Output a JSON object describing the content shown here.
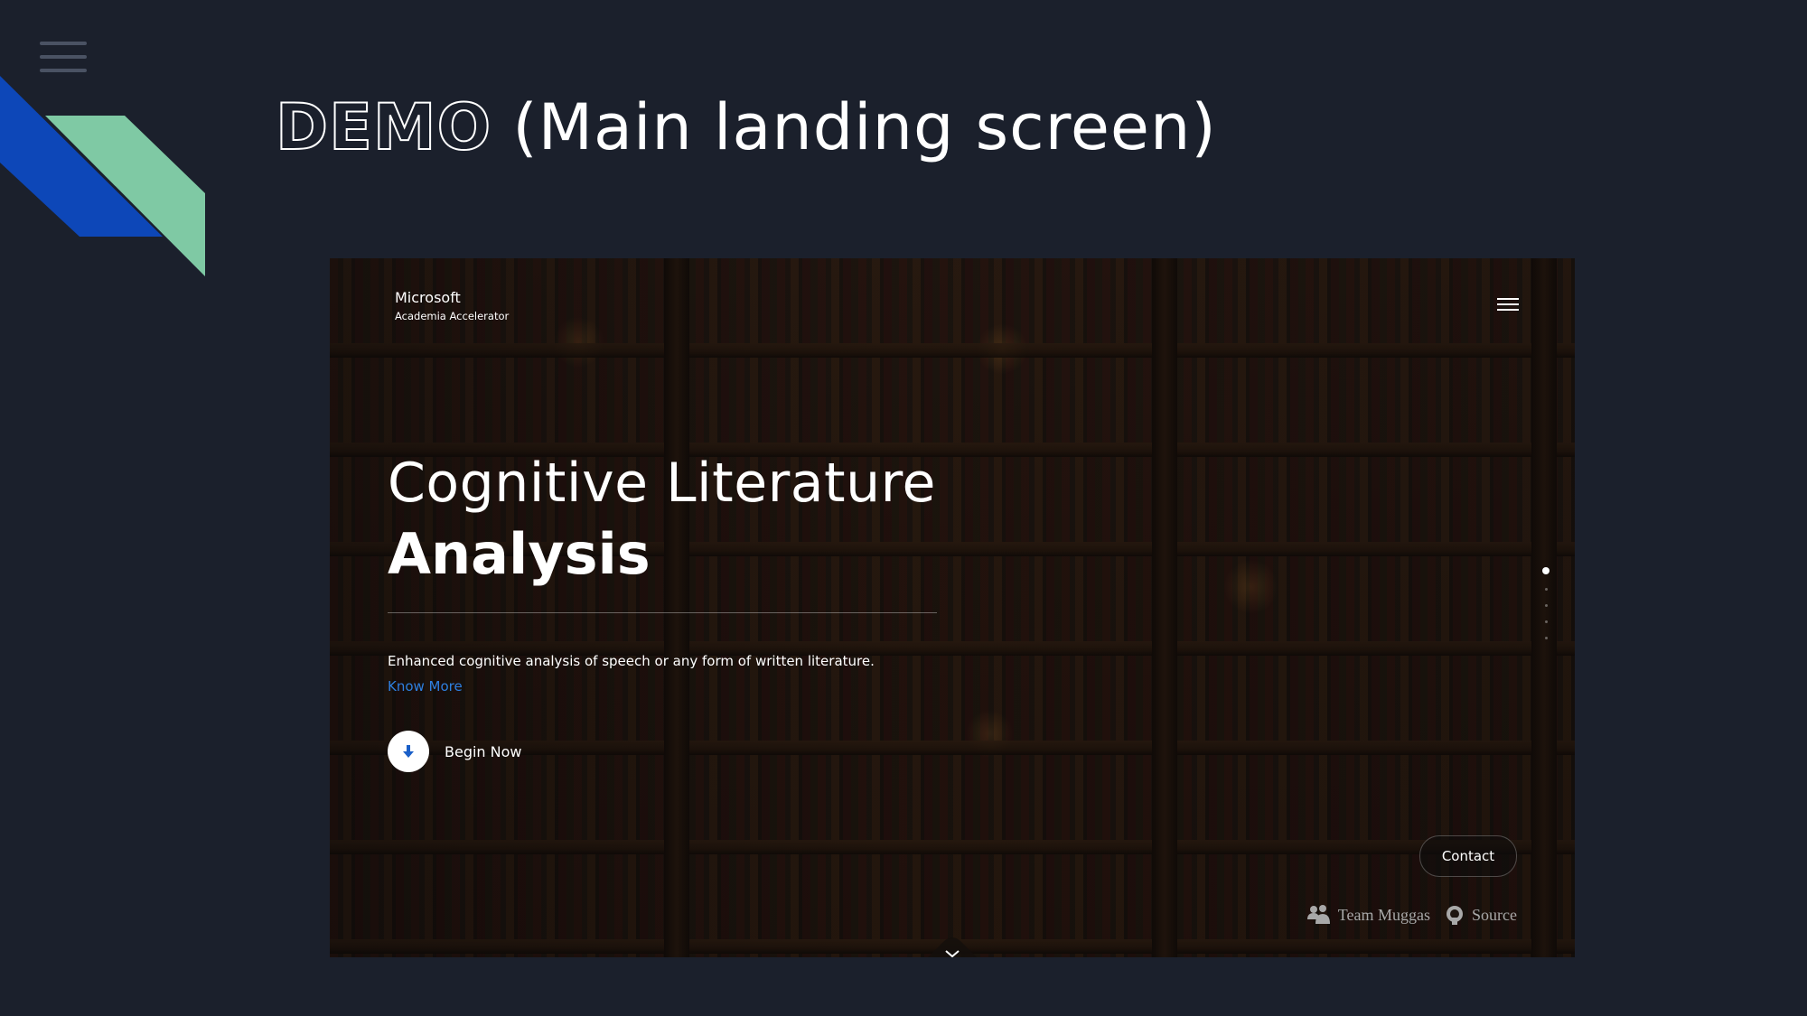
{
  "slide": {
    "title_outline": "DEMO",
    "title_rest": " (Main landing screen)"
  },
  "screenshot": {
    "brand": {
      "name": "Microsoft",
      "subtitle": "Academia Accelerator"
    },
    "headline": {
      "line1": "Cognitive Literature",
      "line2": "Analysis"
    },
    "description": "Enhanced cognitive analysis of speech or any form of written literature.",
    "know_more_link": "Know More",
    "begin_button": "Begin Now",
    "contact_button": "Contact",
    "footer": {
      "team": "Team Muggas",
      "source": "Source"
    },
    "section_dots": {
      "count": 5,
      "active_index": 0
    }
  },
  "colors": {
    "slide_background": "#1b202c",
    "deco_blue": "#0d47b8",
    "deco_green": "#7fc9a4",
    "link_blue": "#2e7fe0"
  },
  "icons": {
    "slide_menu": "hamburger-icon",
    "site_menu": "hamburger-icon",
    "begin": "arrow-down-icon",
    "team": "users-icon",
    "source": "github-icon",
    "scroll": "chevron-down-icon"
  }
}
